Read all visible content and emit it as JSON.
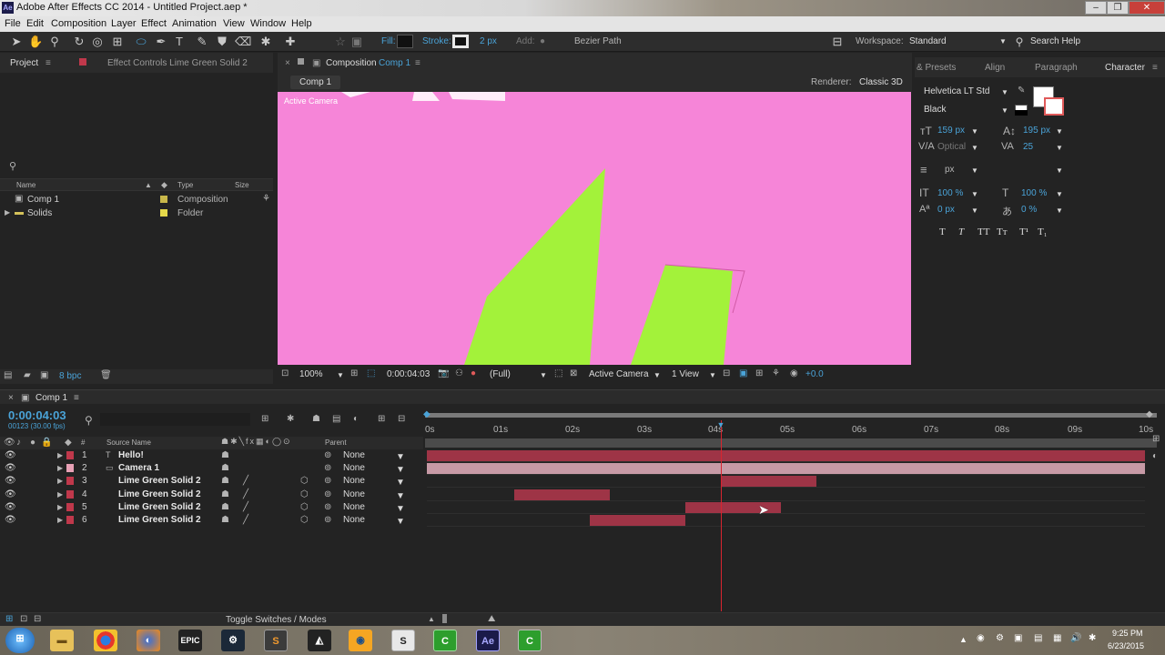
{
  "window": {
    "title": "Adobe After Effects CC 2014 - Untitled Project.aep *",
    "app_icon": "Ae"
  },
  "menubar": [
    "File",
    "Edit",
    "Composition",
    "Layer",
    "Effect",
    "Animation",
    "View",
    "Window",
    "Help"
  ],
  "toolbar": {
    "fill_label": "Fill:",
    "stroke_label": "Stroke:",
    "stroke_width": "2 px",
    "add_label": "Add:",
    "bezier_label": "Bezier Path",
    "workspace_label": "Workspace:",
    "workspace_value": "Standard",
    "search_placeholder": "Search Help"
  },
  "project_panel": {
    "tab_project": "Project",
    "tab_effect_controls": "Effect Controls Lime Green Solid 2",
    "columns": {
      "name": "Name",
      "type": "Type",
      "size": "Size"
    },
    "items": [
      {
        "name": "Comp 1",
        "type": "Composition",
        "color": "#c8b74a"
      },
      {
        "name": "Solids",
        "type": "Folder",
        "color": "#e5d94a"
      }
    ],
    "bpc": "8 bpc"
  },
  "composition_panel": {
    "tab_label": "Composition",
    "tab_comp": "Comp 1",
    "sub_tab": "Comp 1",
    "renderer_label": "Renderer:",
    "renderer_value": "Classic 3D",
    "camera_label": "Active Camera",
    "zoom": "100%",
    "timecode": "0:00:04:03",
    "resolution": "(Full)",
    "view_camera": "Active Camera",
    "view_count": "1 View",
    "exposure": "+0.0"
  },
  "right_panel": {
    "tabs": [
      "& Presets",
      "Align",
      "Paragraph",
      "Character"
    ],
    "font_family": "Helvetica LT Std",
    "font_style": "Black",
    "font_size": "159 px",
    "leading": "195 px",
    "kerning": "Optical",
    "tracking": "25",
    "stroke_unit": "px",
    "vert_scale": "100 %",
    "horiz_scale": "100 %",
    "baseline_shift": "0 px",
    "tsume": "0 %",
    "type_buttons": [
      "T",
      "T",
      "TT",
      "Tт",
      "T¹",
      "T₁"
    ]
  },
  "timeline": {
    "tab_label": "Comp 1",
    "timecode": "0:00:04:03",
    "frames": "00123 (30.00 fps)",
    "col_num": "#",
    "col_source": "Source Name",
    "col_parent": "Parent",
    "ruler": [
      "0s",
      "01s",
      "02s",
      "03s",
      "04s",
      "05s",
      "06s",
      "07s",
      "08s",
      "09s",
      "10s"
    ],
    "layers": [
      {
        "num": "1",
        "name": "Hello!",
        "kind": "text",
        "color": "#c0384b",
        "parent": "None",
        "bar_start": 0,
        "bar_end": 10,
        "bar_color": "#9e3446"
      },
      {
        "num": "2",
        "name": "Camera 1",
        "kind": "camera",
        "color": "#e8a1b6",
        "parent": "None",
        "bar_start": 0,
        "bar_end": 10,
        "bar_color": "#c79aa6"
      },
      {
        "num": "3",
        "name": "Lime Green Solid 2",
        "kind": "solid",
        "color": "#c0384b",
        "parent": "None",
        "bar_start": 4.1,
        "bar_end": 5.43,
        "bar_color": "#9e3446"
      },
      {
        "num": "4",
        "name": "Lime Green Solid 2",
        "kind": "solid",
        "color": "#c0384b",
        "parent": "None",
        "bar_start": 1.22,
        "bar_end": 2.55,
        "bar_color": "#9e3446"
      },
      {
        "num": "5",
        "name": "Lime Green Solid 2",
        "kind": "solid",
        "color": "#c0384b",
        "parent": "None",
        "bar_start": 3.6,
        "bar_end": 4.93,
        "bar_color": "#9e3446"
      },
      {
        "num": "6",
        "name": "Lime Green Solid 2",
        "kind": "solid",
        "color": "#c0384b",
        "parent": "None",
        "bar_start": 2.27,
        "bar_end": 3.6,
        "bar_color": "#9e3446"
      }
    ],
    "playhead_seconds": 4.1,
    "duration_seconds": 10,
    "toggle_label": "Toggle Switches / Modes"
  },
  "taskbar": {
    "time": "9:25 PM",
    "date": "6/23/2015",
    "icons": [
      "start-orb",
      "explorer",
      "chrome",
      "firefox",
      "epic-games",
      "steam",
      "sublime",
      "unity",
      "blender",
      "skype",
      "cinema",
      "after-effects",
      "camtasia"
    ]
  },
  "colors": {
    "canvas": "#f685d8",
    "lime": "#a3f23a",
    "accent_blue": "#4aa3d8",
    "playhead": "#d9242f",
    "layer_bar": "#9e3446"
  }
}
